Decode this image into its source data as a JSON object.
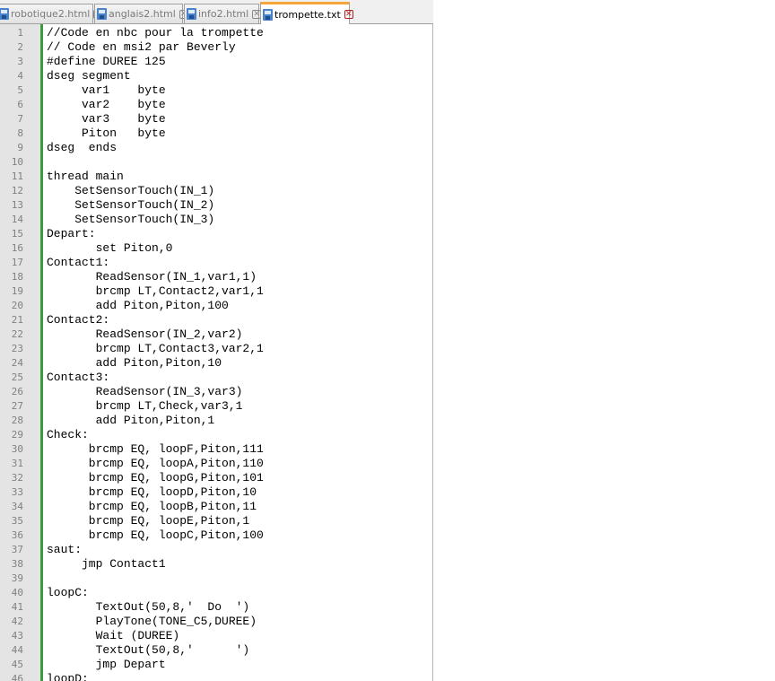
{
  "tabs": [
    {
      "label": "robotique2.html",
      "active": false
    },
    {
      "label": "anglais2.html",
      "active": false
    },
    {
      "label": "info2.html",
      "active": false
    },
    {
      "label": "trompette.txt",
      "active": true
    }
  ],
  "colors": {
    "active_tab_accent": "#f5a53a",
    "fold_margin": "#3c9a3c",
    "file_icon": "#4a83c9",
    "close_active": "#c62020"
  },
  "icons": {
    "file": "save-file-icon",
    "close": "close-tab-icon"
  },
  "editor": {
    "lines": [
      {
        "num": "1",
        "text": "//Code en nbc pour la trompette"
      },
      {
        "num": "2",
        "text": "// Code en msi2 par Beverly"
      },
      {
        "num": "3",
        "text": "#define DUREE 125"
      },
      {
        "num": "4",
        "text": "dseg segment"
      },
      {
        "num": "5",
        "text": "     var1    byte"
      },
      {
        "num": "6",
        "text": "     var2    byte"
      },
      {
        "num": "7",
        "text": "     var3    byte"
      },
      {
        "num": "8",
        "text": "     Piton   byte"
      },
      {
        "num": "9",
        "text": "dseg  ends"
      },
      {
        "num": "10",
        "text": ""
      },
      {
        "num": "11",
        "text": "thread main"
      },
      {
        "num": "12",
        "text": "    SetSensorTouch(IN_1)"
      },
      {
        "num": "13",
        "text": "    SetSensorTouch(IN_2)"
      },
      {
        "num": "14",
        "text": "    SetSensorTouch(IN_3)"
      },
      {
        "num": "15",
        "text": "Depart:"
      },
      {
        "num": "16",
        "text": "       set Piton,0"
      },
      {
        "num": "17",
        "text": "Contact1:"
      },
      {
        "num": "18",
        "text": "       ReadSensor(IN_1,var1,1)"
      },
      {
        "num": "19",
        "text": "       brcmp LT,Contact2,var1,1"
      },
      {
        "num": "20",
        "text": "       add Piton,Piton,100"
      },
      {
        "num": "21",
        "text": "Contact2:"
      },
      {
        "num": "22",
        "text": "       ReadSensor(IN_2,var2)"
      },
      {
        "num": "23",
        "text": "       brcmp LT,Contact3,var2,1"
      },
      {
        "num": "24",
        "text": "       add Piton,Piton,10"
      },
      {
        "num": "25",
        "text": "Contact3:"
      },
      {
        "num": "26",
        "text": "       ReadSensor(IN_3,var3)"
      },
      {
        "num": "27",
        "text": "       brcmp LT,Check,var3,1"
      },
      {
        "num": "28",
        "text": "       add Piton,Piton,1"
      },
      {
        "num": "29",
        "text": "Check:"
      },
      {
        "num": "30",
        "text": "      brcmp EQ, loopF,Piton,111"
      },
      {
        "num": "31",
        "text": "      brcmp EQ, loopA,Piton,110"
      },
      {
        "num": "32",
        "text": "      brcmp EQ, loopG,Piton,101"
      },
      {
        "num": "33",
        "text": "      brcmp EQ, loopD,Piton,10"
      },
      {
        "num": "34",
        "text": "      brcmp EQ, loopB,Piton,11"
      },
      {
        "num": "35",
        "text": "      brcmp EQ, loopE,Piton,1"
      },
      {
        "num": "36",
        "text": "      brcmp EQ, loopC,Piton,100"
      },
      {
        "num": "37",
        "text": "saut:"
      },
      {
        "num": "38",
        "text": "     jmp Contact1"
      },
      {
        "num": "39",
        "text": ""
      },
      {
        "num": "40",
        "text": "loopC:"
      },
      {
        "num": "41",
        "text": "       TextOut(50,8,'  Do  ')"
      },
      {
        "num": "42",
        "text": "       PlayTone(TONE_C5,DUREE)"
      },
      {
        "num": "43",
        "text": "       Wait (DUREE)"
      },
      {
        "num": "44",
        "text": "       TextOut(50,8,'      ')"
      },
      {
        "num": "45",
        "text": "       jmp Depart"
      },
      {
        "num": "46",
        "text": "loopD:"
      }
    ]
  }
}
